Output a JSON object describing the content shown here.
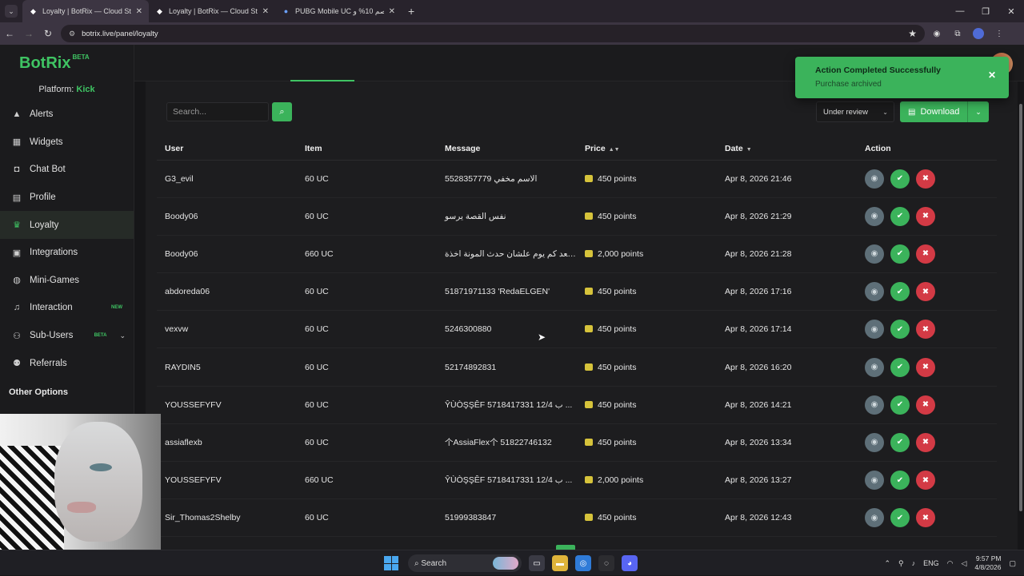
{
  "browser": {
    "tabs": [
      {
        "title": "Loyalty | BotRix — Cloud Stream",
        "active": true,
        "icon": "botrix-favicon"
      },
      {
        "title": "Loyalty | BotRix — Cloud Stream",
        "active": false,
        "icon": "botrix-favicon"
      },
      {
        "title": "PUBG Mobile UC خصم 10% و |",
        "active": false,
        "icon": "pubg-favicon"
      }
    ],
    "url": "botrix.live/panel/loyalty"
  },
  "app": {
    "brand": "BotRix",
    "brand_badge": "BETA",
    "platform_label": "Platform:",
    "platform_value": "Kick",
    "nav": [
      {
        "label": "Alerts",
        "icon": "warning-icon",
        "active": false
      },
      {
        "label": "Widgets",
        "icon": "grid-icon",
        "active": false
      },
      {
        "label": "Chat Bot",
        "icon": "robot-icon",
        "active": false
      },
      {
        "label": "Profile",
        "icon": "id-card-icon",
        "active": false
      },
      {
        "label": "Loyalty",
        "icon": "trophy-icon",
        "active": true
      },
      {
        "label": "Integrations",
        "icon": "plug-icon",
        "active": false
      },
      {
        "label": "Mini-Games",
        "icon": "gamepad-icon",
        "active": false
      },
      {
        "label": "Interaction",
        "icon": "music-icon",
        "active": false,
        "badge": "NEW"
      },
      {
        "label": "Sub-Users",
        "icon": "users-icon",
        "active": false,
        "badge": "BETA"
      },
      {
        "label": "Referrals",
        "icon": "people-icon",
        "active": false
      }
    ],
    "other_options": "Other Options"
  },
  "toolbar": {
    "search_placeholder": "Search...",
    "status_filter": "Under review",
    "download_label": "Download"
  },
  "table": {
    "headers": {
      "user": "User",
      "item": "Item",
      "message": "Message",
      "price": "Price",
      "date": "Date",
      "action": "Action"
    },
    "rows": [
      {
        "user": "G3_evil",
        "item": "60 UC",
        "message": "5528357779 الاسم مخفي",
        "price": "450 points",
        "date": "Apr 8, 2026 21:46"
      },
      {
        "user": "Boody06",
        "item": "60 UC",
        "message": "نفس القصة يرسو",
        "price": "450 points",
        "date": "Apr 8, 2026 21:29"
      },
      {
        "user": "Boody06",
        "item": "660 UC",
        "message": "ـيا هـول بعد كم يوم علشان حدث المونة اخذة",
        "price": "2,000 points",
        "date": "Apr 8, 2026 21:28"
      },
      {
        "user": "abdoreda06",
        "item": "60 UC",
        "message": "51871971133 'RedaELGEN'",
        "price": "450 points",
        "date": "Apr 8, 2026 17:16"
      },
      {
        "user": "vexvw",
        "item": "60 UC",
        "message": "5246300880",
        "price": "450 points",
        "date": "Apr 8, 2026 17:14"
      },
      {
        "user": "RAYDIN5",
        "item": "60 UC",
        "message": "52174892831",
        "price": "450 points",
        "date": "Apr 8, 2026 16:20"
      },
      {
        "user": "YOUSSEFYFV",
        "item": "60 UC",
        "message": "ŶÙÒŞŞÊF 5718417331 12/4 ب ...",
        "price": "450 points",
        "date": "Apr 8, 2026 14:21"
      },
      {
        "user": "assiaflexb",
        "item": "60 UC",
        "message": "个AssiaFlex个 51822746132",
        "price": "450 points",
        "date": "Apr 8, 2026 13:34"
      },
      {
        "user": "YOUSSEFYFV",
        "item": "660 UC",
        "message": "ŶÙÒŞŞÊF 5718417331 12/4 ب ...",
        "price": "2,000 points",
        "date": "Apr 8, 2026 13:27"
      },
      {
        "user": "Sir_Thomas2Shelby",
        "item": "60 UC",
        "message": "51999383847",
        "price": "450 points",
        "date": "Apr 8, 2026 12:43"
      }
    ]
  },
  "toast": {
    "title": "Action Completed Successfully",
    "message": "Purchase archived"
  },
  "taskbar": {
    "search_label": "Search",
    "language": "ENG",
    "time": "9:57 PM",
    "date": "4/8/2026"
  },
  "colors": {
    "accent": "#3bb35b",
    "danger": "#d33a45",
    "background": "#1d1d1f"
  }
}
